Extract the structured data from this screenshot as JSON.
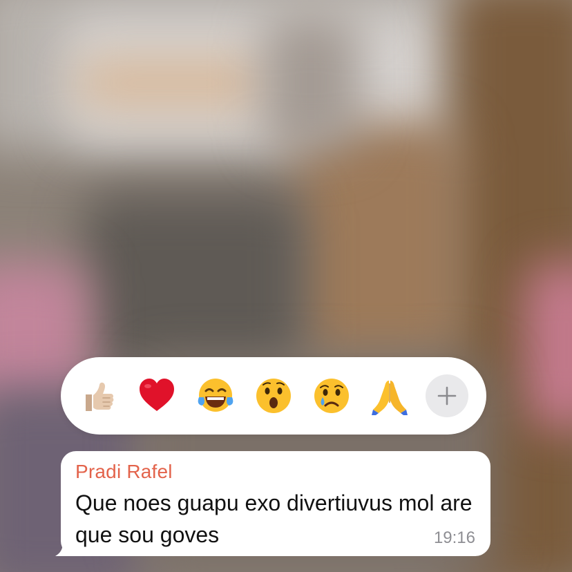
{
  "reaction_bar": {
    "emojis": [
      {
        "name": "thumbs-up",
        "glyph": "👍🏼"
      },
      {
        "name": "red-heart",
        "glyph": "❤️"
      },
      {
        "name": "face-with-tears-of-joy",
        "glyph": "😂"
      },
      {
        "name": "face-with-open-mouth",
        "glyph": "😮"
      },
      {
        "name": "crying-face",
        "glyph": "😢"
      },
      {
        "name": "folded-hands",
        "glyph": "🙏"
      }
    ],
    "more_icon": "plus-icon"
  },
  "message": {
    "sender": "Pradi Rafel",
    "text": "Que noes guapu exo divertiuvus mol are que sou goves",
    "time": "19:16"
  },
  "colors": {
    "sender_name": "#e3634b",
    "bubble": "#ffffff",
    "more_button_bg": "#e9e9eb",
    "timestamp": "#8e8e93"
  }
}
